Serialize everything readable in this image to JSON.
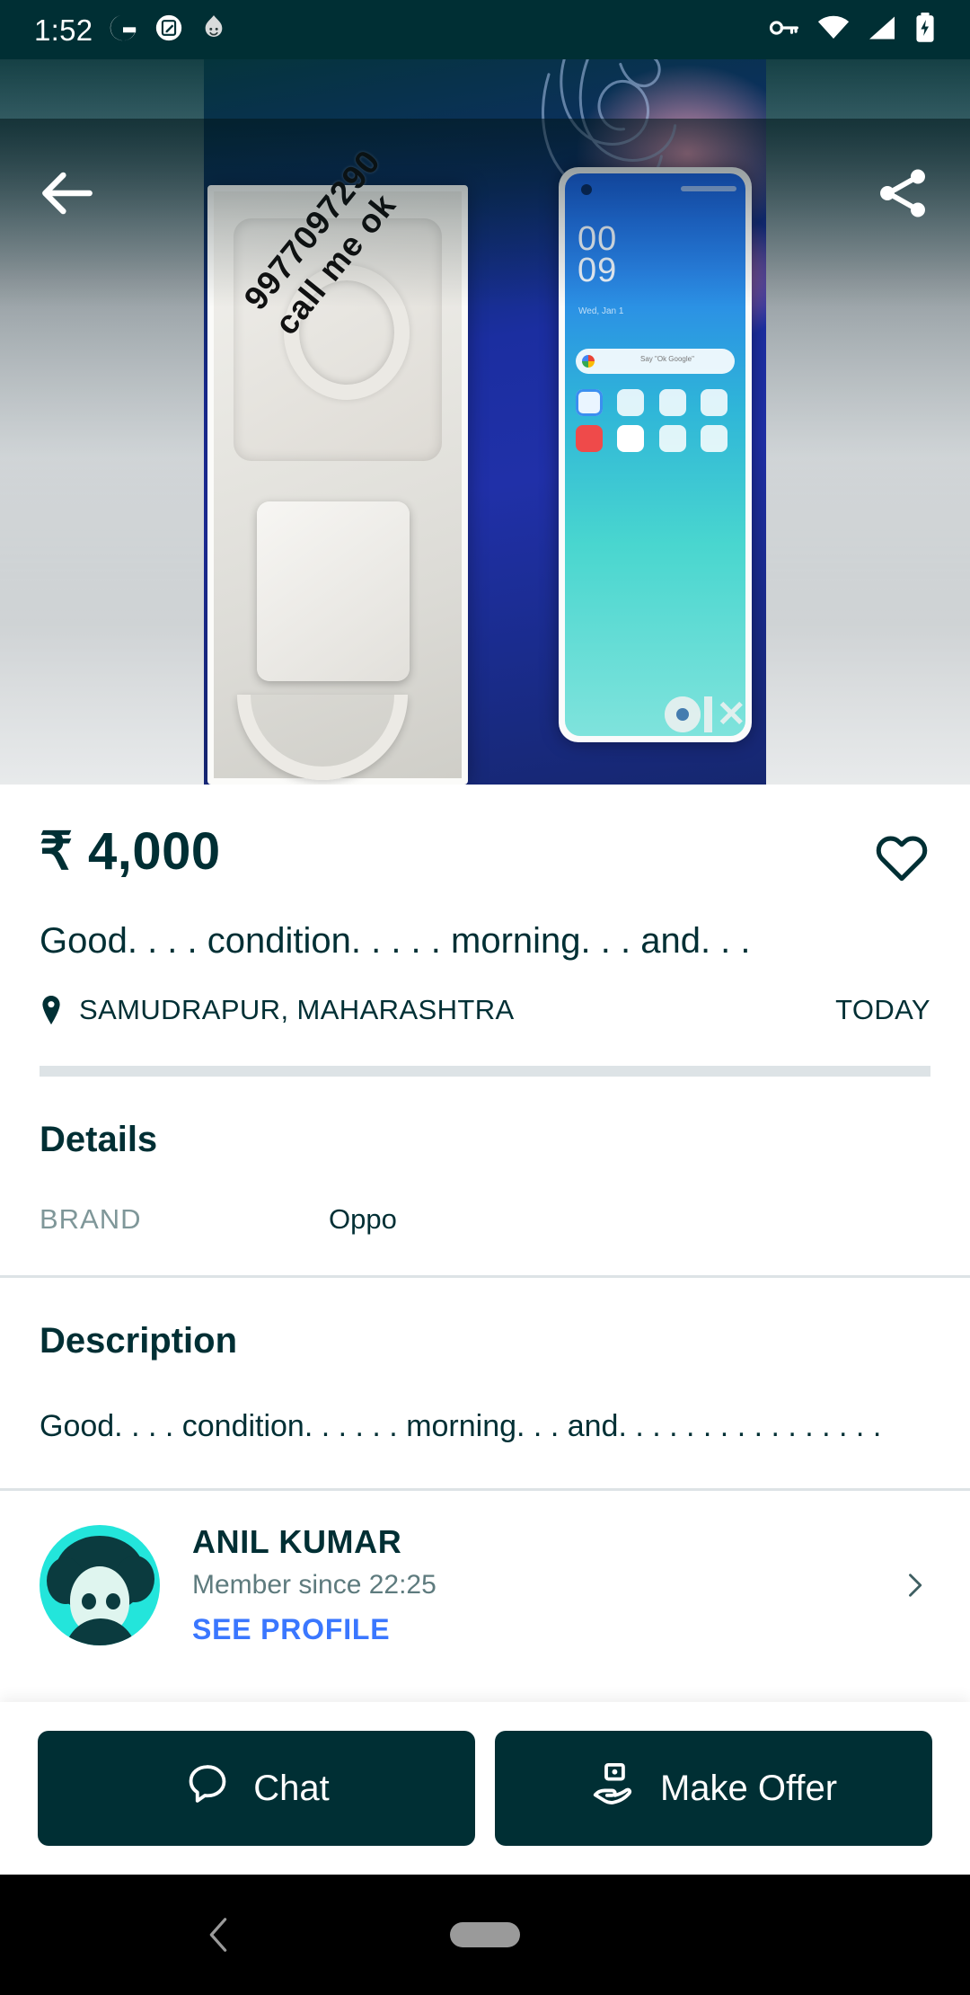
{
  "status_bar": {
    "time": "1:52",
    "left_icons": [
      "google-g-icon",
      "screenshot-edit-icon",
      "flame-smiley-icon"
    ],
    "right_icons": [
      "vpn-key-icon",
      "wifi-icon",
      "cellular-signal-icon",
      "battery-charging-icon"
    ],
    "background_color": "#002f34"
  },
  "gallery": {
    "back_icon": "back-arrow-icon",
    "share_icon": "share-icon",
    "watermark_line1": "9977097290",
    "watermark_line2": "call me ok",
    "brand_watermark": "OLX",
    "phone_clock_hour": "00",
    "phone_clock_min": "09",
    "phone_date": "Wed, Jan 1",
    "phone_search_hint": "Say \"Ok Google\""
  },
  "listing": {
    "price": "₹ 4,000",
    "favorite_icon": "heart-outline-icon",
    "title": "Good. . . .  condition. . . . .  morning. . .  and. . .",
    "location_icon": "location-pin-icon",
    "location": "SAMUDRAPUR, MAHARASHTRA",
    "date": "TODAY"
  },
  "details": {
    "heading": "Details",
    "attributes": [
      {
        "key": "BRAND",
        "value": "Oppo"
      }
    ]
  },
  "description": {
    "heading": "Description",
    "text": "Good. . . .  condition. . . . . . morning. . . and. . . . . . . . . . . . . . . ."
  },
  "seller": {
    "avatar_icon": "user-avatar-icon",
    "name": "ANIL KUMAR",
    "member_since": "Member since 22:25",
    "see_profile": "SEE PROFILE",
    "chevron_icon": "chevron-right-icon"
  },
  "actions": {
    "chat_label": "Chat",
    "chat_icon": "chat-bubble-icon",
    "offer_label": "Make Offer",
    "offer_icon": "hand-offer-icon"
  },
  "system_nav": {
    "back_icon": "nav-back-icon",
    "home_icon": "nav-home-pill-icon"
  },
  "colors": {
    "brand_dark": "#002f34",
    "link_blue": "#3a77ff",
    "divider": "#dde3e6",
    "muted": "#7f9799",
    "avatar_bg": "#23e5db"
  }
}
